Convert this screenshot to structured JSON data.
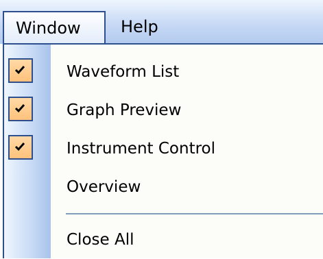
{
  "menubar": {
    "items": [
      {
        "label": "Window"
      },
      {
        "label": "Help"
      }
    ]
  },
  "window_menu": {
    "items": [
      {
        "label": "Waveform List",
        "checked": true
      },
      {
        "label": "Graph Preview",
        "checked": true
      },
      {
        "label": "Instrument Control",
        "checked": true
      },
      {
        "label": "Overview",
        "checked": false
      },
      {
        "label": "Close All",
        "checked": false
      }
    ]
  },
  "colors": {
    "menu_border": "#2d4f8d",
    "check_fill": "#ffc27c",
    "separator": "#7f9db9"
  },
  "icons": {
    "check": "checkmark-icon"
  }
}
